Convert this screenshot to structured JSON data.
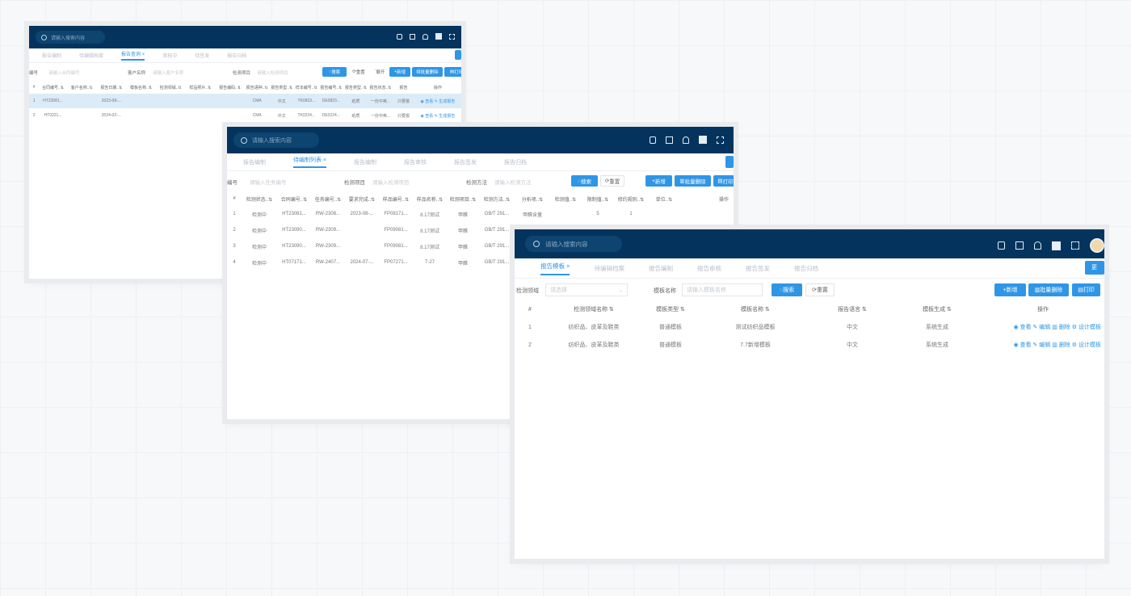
{
  "search_placeholder": "请输入搜索内容",
  "w1": {
    "tabs": [
      "报告编制",
      "待编辑档案",
      "报告查询",
      "审核中",
      "待签发",
      "报告归档"
    ],
    "more_label": "",
    "filters": {
      "l1": "编号",
      "p1": "请输入合同编号",
      "l2": "客户名称",
      "p2": "请输入客户名称",
      "l3": "检测项目",
      "p3": "请输入检测项目"
    },
    "buttons": {
      "search": "搜索",
      "reset": "重置",
      "adv": "展开",
      "add": "新增",
      "batch": "批量删除",
      "print": "打印"
    },
    "columns": [
      "#",
      "合同编号",
      "客户名称",
      "报告日期",
      "模板名称",
      "检测领域",
      "样品照片",
      "报告编码",
      "报告语种",
      "报告类型",
      "样本编号",
      "报告编号",
      "报告类型",
      "报告状态",
      "报告",
      "操作"
    ],
    "rows": [
      [
        "1",
        "HT23081...",
        "",
        "2023-08-...",
        "",
        "",
        "",
        "",
        "CMA",
        "中文",
        "TK0823...",
        "DE0823...",
        "纸质",
        "一份中英...",
        "只要报",
        "查看",
        "生成报告"
      ],
      [
        "2",
        "HT0221...",
        "",
        "2024-02-...",
        "",
        "",
        "",
        "",
        "CMA",
        "中文",
        "TK0224...",
        "DE0224...",
        "纸质",
        "一份中英...",
        "只要报",
        "查看",
        "生成报告"
      ]
    ]
  },
  "w2": {
    "tabs": [
      "报告编制",
      "待编制列表",
      "报告编制",
      "报告审核",
      "报告签发",
      "报告归档"
    ],
    "filters": {
      "l1": "编号",
      "p1": "请输入任务编号",
      "l2": "检测项目",
      "p2": "请输入检测项目",
      "l3": "检测方法",
      "p3": "请输入检测方法"
    },
    "buttons": {
      "search": "搜索",
      "reset": "重置",
      "add": "新增",
      "batch": "批量删除",
      "print": "打印"
    },
    "columns": [
      "#",
      "检测状态",
      "合同编号",
      "任务编号",
      "要求完成",
      "样品编号",
      "样品名称",
      "检测项目",
      "检测方法",
      "分析项",
      "检测值",
      "限制值",
      "修约规则",
      "单位",
      "操作"
    ],
    "rows": [
      [
        "1",
        "检测中",
        "HT23081...",
        "RW-2308...",
        "2023-08-...",
        "FP08171...",
        "8.17测试",
        "甲醛",
        "GB/T 291...",
        "甲醛含量",
        "",
        "5",
        "1",
        ""
      ],
      [
        "2",
        "检测中",
        "HT23090...",
        "RW-2309...",
        "",
        "FP09081...",
        "8.17测试",
        "甲醛",
        "GB/T 291...",
        "",
        "",
        "",
        "",
        ""
      ],
      [
        "3",
        "检测中",
        "HT23090...",
        "RW-2309...",
        "",
        "FP09081...",
        "8.17测试",
        "甲醛",
        "GB/T 291...",
        "",
        "",
        "",
        "",
        ""
      ],
      [
        "4",
        "检测中",
        "HT07171...",
        "RW-2407...",
        "2024-07-...",
        "FP07271...",
        "7-27",
        "甲醛",
        "GB/T 291...",
        "",
        "",
        "",
        "",
        ""
      ]
    ]
  },
  "w3": {
    "tabs": [
      "报告模板",
      "待编辑档案",
      "报告编制",
      "报告审核",
      "报告签发",
      "报告归档"
    ],
    "more_label": "更",
    "filters": {
      "l1": "检测领域",
      "p1": "请选择",
      "l2": "模板名称",
      "p2": "请输入模板名称"
    },
    "buttons": {
      "search": "搜索",
      "reset": "重置",
      "add": "新增",
      "batch": "批量删除",
      "print": "打印"
    },
    "columns": [
      "#",
      "检测领域名称",
      "模板类型",
      "模板名称",
      "报告语言",
      "模板生成",
      "操作"
    ],
    "rows": [
      [
        "1",
        "纺织品、皮革及鞋类",
        "普通模板",
        "测试纺织品模板",
        "中文",
        "系统生成"
      ],
      [
        "2",
        "纺织品、皮革及鞋类",
        "普通模板",
        "7.7新增模板",
        "中文",
        "系统生成"
      ]
    ],
    "ops": [
      "查看",
      "编辑",
      "删除",
      "设计模板"
    ]
  }
}
